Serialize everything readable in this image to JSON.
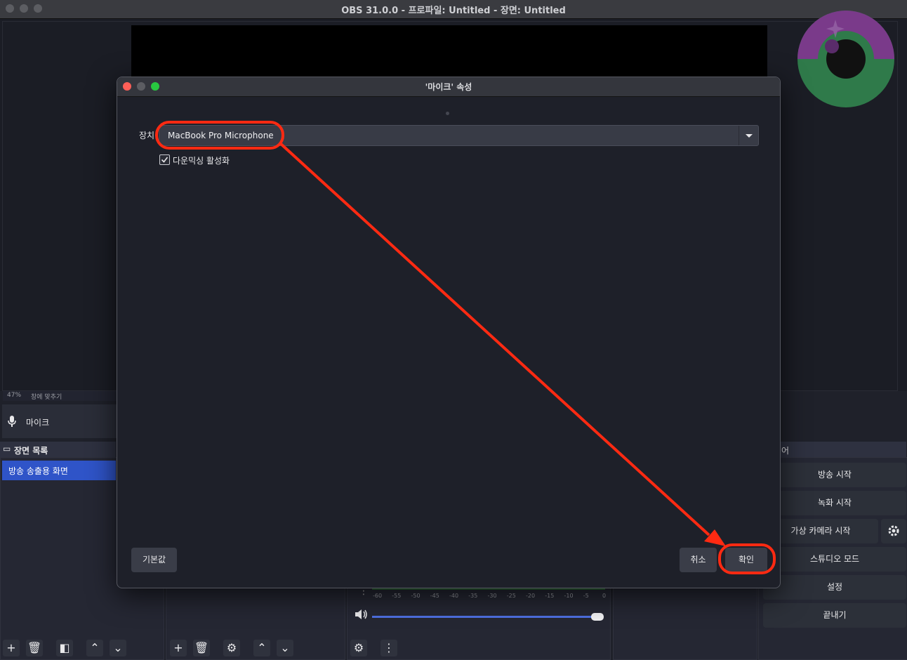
{
  "window": {
    "title": "OBS 31.0.0 - 프로파일: Untitled - 장면: Untitled"
  },
  "preview": {
    "zoom": "47%",
    "fit_label": "창에 맞추기"
  },
  "audio_source": {
    "name": "마이크"
  },
  "scenes": {
    "header": "장면 목록",
    "items": [
      "방송 송출용 화면"
    ]
  },
  "controls": {
    "header": "어",
    "start_streaming": "방송 시작",
    "start_recording": "녹화 시작",
    "start_virtual_camera": "가상 카메라 시작",
    "studio_mode": "스튜디오 모드",
    "settings": "설정",
    "exit": "끝내기"
  },
  "mixer": {
    "scale": [
      "-60",
      "-55",
      "-50",
      "-45",
      "-40",
      "-35",
      "-30",
      "-25",
      "-20",
      "-15",
      "-10",
      "-5",
      "0"
    ],
    "volume_fraction": 1.0
  },
  "dialog": {
    "title": "'마이크' 속성",
    "device_label": "장치",
    "device_value": "MacBook Pro Microphone",
    "downmix_label": "다운믹싱 활성화",
    "downmix_checked": true,
    "defaults_button": "기본값",
    "cancel_button": "취소",
    "ok_button": "확인"
  },
  "colors": {
    "accent": "#2f54c8",
    "annotation": "#ff2a12",
    "close": "#ff5f57",
    "zoom_green": "#28c840"
  }
}
